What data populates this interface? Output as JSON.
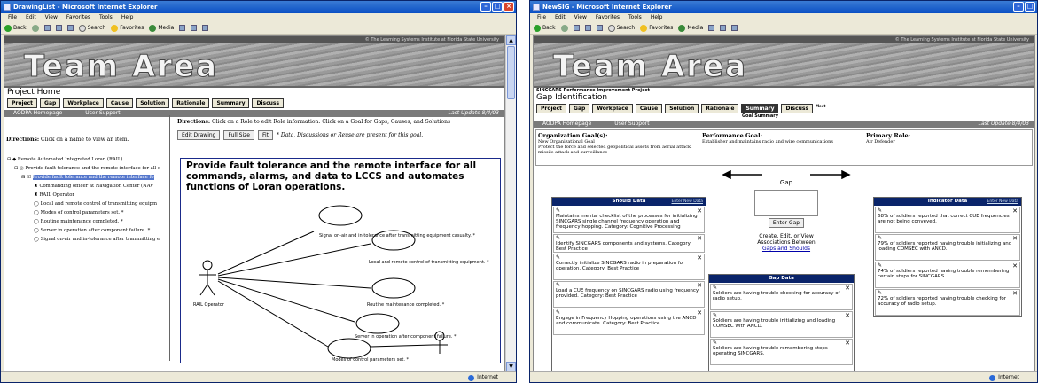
{
  "left_window": {
    "title": "DrawingList - Microsoft Internet Explorer",
    "menu": [
      "File",
      "Edit",
      "View",
      "Favorites",
      "Tools",
      "Help"
    ],
    "toolbar": {
      "back": "Back",
      "search": "Search",
      "favorites": "Favorites",
      "media": "Media"
    },
    "copyright": "© The Learning Systems Institute at Florida State University",
    "banner": "Team Area",
    "page_title": "Project Home",
    "tabs": [
      "Project",
      "Gap",
      "Workplace",
      "Cause",
      "Solution",
      "Rationale",
      "Summary",
      "Discuss"
    ],
    "links": [
      "AODPA Homepage",
      "User Support"
    ],
    "last_update": "Last Update 8/4/03",
    "left_directions_label": "Directions:",
    "left_directions_text": "Click on a name to view an item.",
    "tree": [
      "Remote Automated Integrated Loran (RAIL)",
      "Provide fault tolerance and the remote interface for all c",
      "Provide fault tolerance and the remote interface fo",
      "Commanding officer at Navigation Center (NAV",
      "RAIL Operator",
      "Local and remote control of transmitting equipm",
      "Modes of control parameters set. *",
      "Routine maintenance completed. *",
      "Server in operation after component failure. *",
      "Signal on-air and in-tolerance after transmitting e"
    ],
    "right_directions_label": "Directions:",
    "right_directions_text": "Click on a Role to edit Role information.  Click on a Goal for Gaps, Causes, and Solutions",
    "buttons": {
      "edit": "Edit Drawing",
      "full": "Full Size",
      "fit": "Fit"
    },
    "note": "* Data, Discussions or Reuse are present for this goal.",
    "goal_title": "Provide fault tolerance and the remote interface for all commands, alarms, and data to LCCS and automates functions of Loran operations.",
    "actor": "RAIL Operator",
    "usecases": [
      "Signal on-air and in-tolerance after transmitting equipment casualty. *",
      "Local and remote control of transmitting equipment. *",
      "Routine maintenance completed. *",
      "Server in operation after component failure. *",
      "Modes of control parameters set. *"
    ],
    "status": "Internet"
  },
  "right_window": {
    "title": "NewSIG - Microsoft Internet Explorer",
    "menu": [
      "File",
      "Edit",
      "View",
      "Favorites",
      "Tools",
      "Help"
    ],
    "toolbar": {
      "back": "Back",
      "search": "Search",
      "favorites": "Favorites",
      "media": "Media"
    },
    "copyright": "© The Learning Systems Institute at Florida State University",
    "banner": "Team Area",
    "project_subtitle": "SINCGARS Performance Improvement Project",
    "page_title": "Gap Identification",
    "tabs": [
      "Project",
      "Gap",
      "Workplace",
      "Cause",
      "Solution",
      "Rationale",
      "Summary",
      "Discuss",
      "Meet"
    ],
    "summary_sub": "Goal Summary",
    "links": [
      "AODPA Homepage",
      "User Support"
    ],
    "last_update": "Last Update 8/4/03",
    "org_goal_label": "Organization Goal(s):",
    "org_goal_line1": "New Organizational Goal",
    "org_goal_line2": "Protect the force and selected geopolitical assets from aerial attack, missile attack and surveillance",
    "perf_goal_label": "Performance Goal:",
    "perf_goal_text": "Establisher and maintains radio and wire communications",
    "primary_role_label": "Primary Role:",
    "primary_role_text": "Air Defender",
    "should_header": "Should Data",
    "enter_new": "Enter New Data",
    "should_items": [
      "Maintains mental checklist of the processes for initializing SINCGARS single channel frequency operation and frequency hopping. Category: Cognitive Processing",
      "Identify SINCGARS components and systems. Category: Best Practice",
      "Correctly initialize SINCGARS radio in preparation for operation. Category: Best Practice",
      "Load a CUE frequency on SINCGARS radio using frequency provided. Category: Best Practice",
      "Engage in Frequency Hopping operations using the ANCD and communicate. Category: Best Practice"
    ],
    "gap_label": "Gap",
    "enter_gap": "Enter Gap",
    "gap_links_text": "Create, Edit, or View Associations Between",
    "gap_links_link": "Gaps and Shoulds",
    "gap_data_header": "Gap Data",
    "gap_items": [
      "Soldiers are having trouble checking for accuracy of radio setup.",
      "Soldiers are having trouble initializing and loading COMSEC with ANCD.",
      "Soldiers are having trouble remembering steps operating SINCGARS."
    ],
    "indicator_header": "Indicator Data",
    "indicator_items": [
      "68% of soldiers reported that correct CUE frequencies are not being conveyed.",
      "79% of soldiers reported having trouble initializing and loading COMSEC with ANCD.",
      "74% of soldiers reported having trouble remembering certain steps for SINCGARS.",
      "72% of soldiers reported having trouble checking for accuracy of radio setup."
    ],
    "status": "Internet"
  }
}
